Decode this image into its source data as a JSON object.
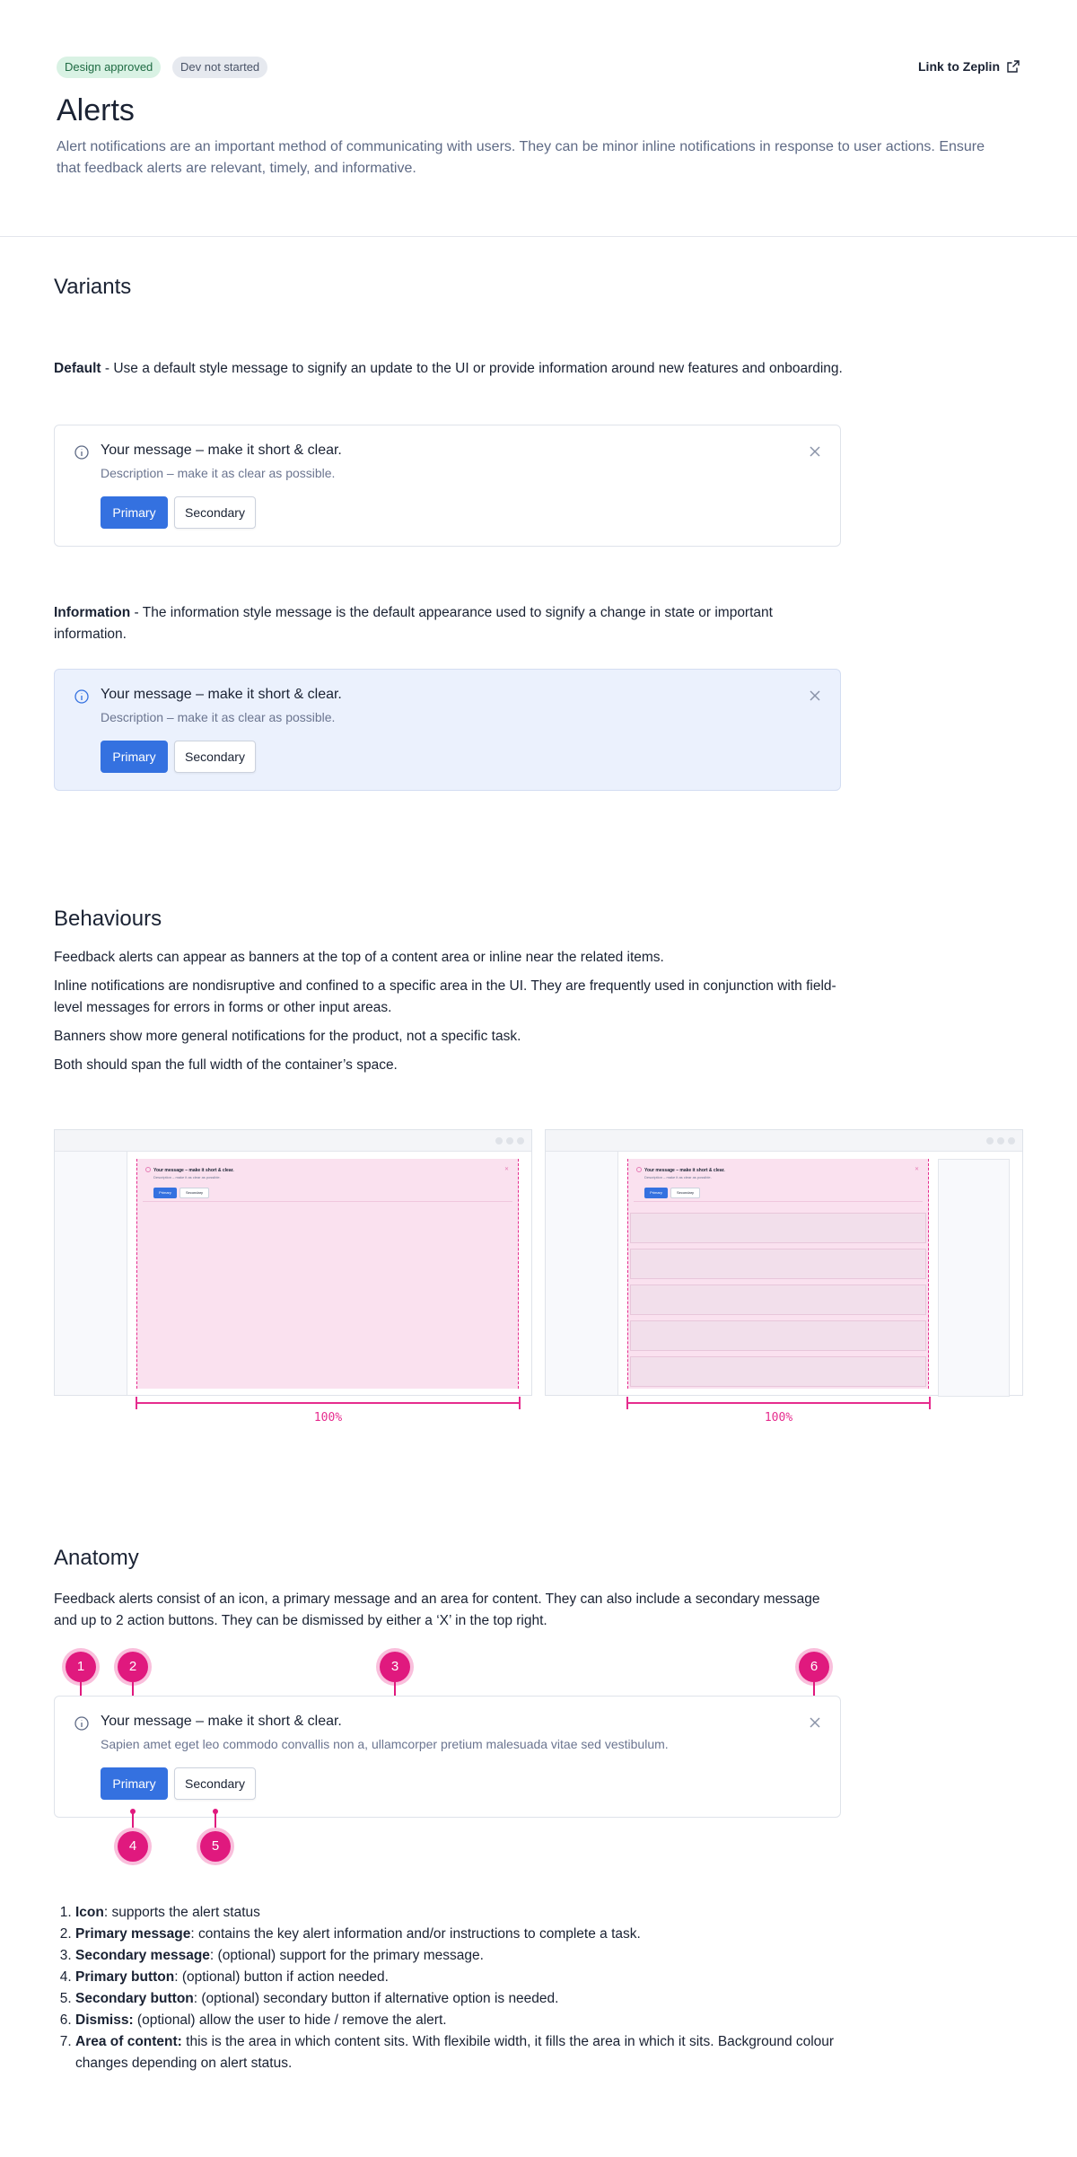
{
  "header": {
    "badge_approved": "Design approved",
    "badge_dev": "Dev not started",
    "zeplin_link": "Link to Zeplin",
    "title": "Alerts",
    "description": "Alert notifications are an important method of communicating with users. They can be minor inline notifications in response to user actions. Ensure that feedback alerts are relevant, timely, and informative."
  },
  "variants": {
    "heading": "Variants",
    "default_term": "Default",
    "default_text": " - Use a default style message to signify an update to the UI or provide information around new features and onboarding.",
    "information_term": "Information",
    "information_text": " - The information style message is the default appearance used to signify a change in state or important information.",
    "alert": {
      "title": "Your message – make it short & clear.",
      "description": "Description – make it as clear as possible.",
      "primary_label": "Primary",
      "secondary_label": "Secondary"
    },
    "colors": {
      "default_bg": "#ffffff",
      "info_bg": "#ebf1fd",
      "primary": "#3471e0"
    }
  },
  "behaviours": {
    "heading": "Behaviours",
    "p1": "Feedback alerts can appear as banners at the top of a content area or inline near the related items.",
    "p2": "Inline notifications are nondisruptive and confined to a specific area in the UI. They are frequently used in conjunction with field-level messages for errors in forms or other input areas.",
    "p3": "Banners show more general notifications for the product, not a specific task.",
    "p4": "Both should span the full width of the container’s space.",
    "mock_alert": {
      "title": "Your message – make it short & clear.",
      "description": "Description – make it as clear as possible.",
      "primary_label": "Primary",
      "secondary_label": "Secondary"
    },
    "width_label_left": "100%",
    "width_label_right": "100%",
    "accent_color": "#e62c8e"
  },
  "anatomy": {
    "heading": "Anatomy",
    "description": "Feedback alerts consist of an icon, a primary message and an area for content. They can also include a secondary message and up to 2 action buttons. They can be dismissed by either a ‘X’ in the top right.",
    "alert": {
      "title": "Your message – make it short & clear.",
      "description": "Sapien amet eget leo commodo convallis non a, ullamcorper pretium malesuada vitae sed vestibulum.",
      "primary_label": "Primary",
      "secondary_label": "Secondary"
    },
    "markers": [
      "1",
      "2",
      "3",
      "6",
      "4",
      "5"
    ],
    "items": [
      {
        "term": "Icon",
        "text": ": supports the alert status"
      },
      {
        "term": "Primary message",
        "text": ": contains the key alert information and/or instructions to complete a task."
      },
      {
        "term": "Secondary message",
        "text": ": (optional) support for the primary message."
      },
      {
        "term": "Primary button",
        "text": ": (optional) button if action needed."
      },
      {
        "term": "Secondary button",
        "text": ": (optional) secondary button if alternative option is needed."
      },
      {
        "term": "Dismiss:",
        "text": " (optional) allow the user to hide / remove the alert."
      },
      {
        "term": "Area of content:",
        "text": " this is the area in which content sits. With flexibile width, it fills the area in which it sits.  Background colour changes depending on alert status."
      }
    ],
    "marker_color": "#e0197e"
  }
}
